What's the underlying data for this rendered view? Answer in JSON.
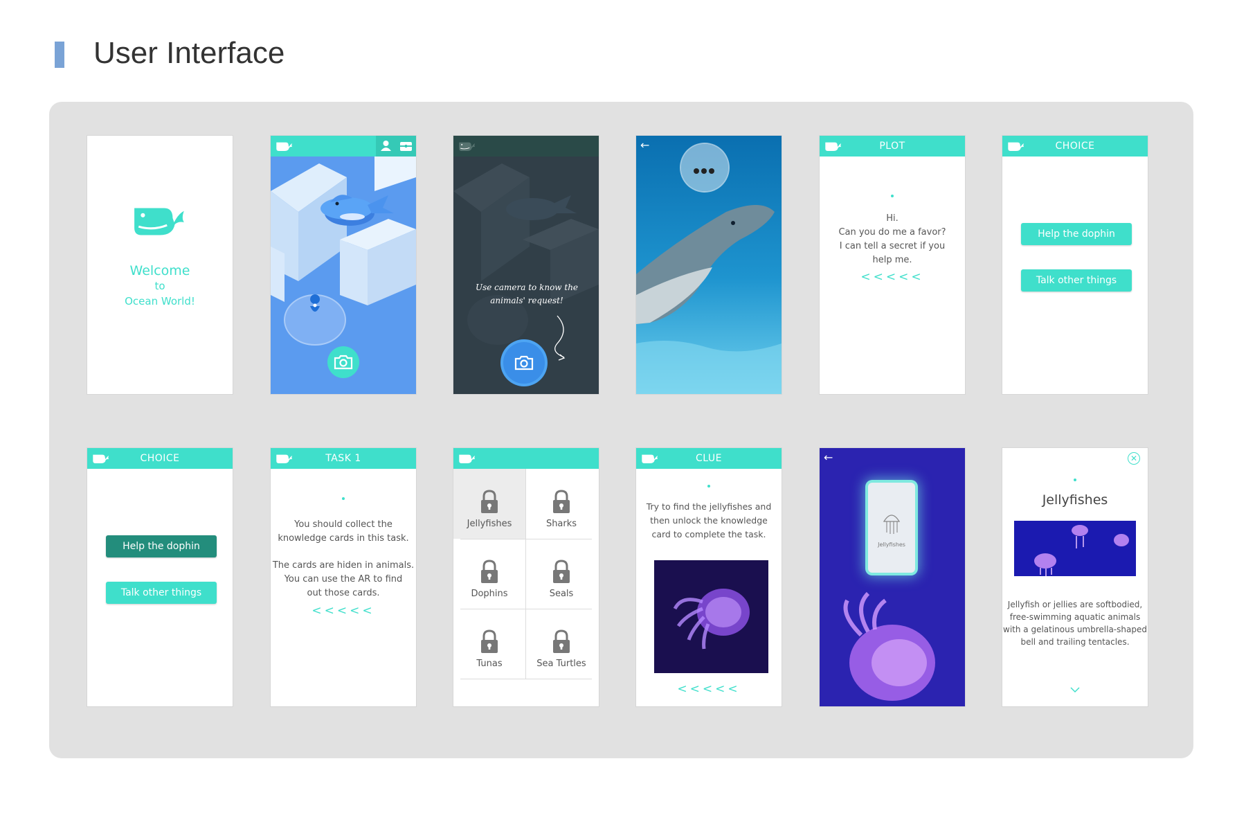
{
  "page": {
    "title": "User Interface"
  },
  "welcome": {
    "line1": "Welcome",
    "line2": "to",
    "line3": "Ocean World!"
  },
  "map_overlay": {
    "hint": "Use camera to know the animals' request!"
  },
  "plot": {
    "header": "PLOT",
    "line1": "Hi.",
    "line2": "Can you do me a favor?",
    "line3": "I can tell a secret if you",
    "line4": "help me.",
    "chevrons": "<<<<<"
  },
  "choice_a": {
    "header": "CHOICE",
    "btn1": "Help the dophin",
    "btn2": "Talk other things"
  },
  "choice_b": {
    "header": "CHOICE",
    "btn1": "Help the dophin",
    "btn2": "Talk other things"
  },
  "task": {
    "header": "TASK 1",
    "line1": "You should collect the",
    "line2": "knowledge cards in this task.",
    "line3": "The cards are hiden in animals.",
    "line4": "You can use the AR to find",
    "line5": "out those cards.",
    "chevrons": "<<<<<"
  },
  "cards": {
    "items": [
      "Jellyfishes",
      "Sharks",
      "Dophins",
      "Seals",
      "Tunas",
      "Sea Turtles"
    ]
  },
  "clue": {
    "header": "CLUE",
    "line1": "Try to find the jellyfishes and",
    "line2": "then unlock the knowledge",
    "line3": "card to complete the task.",
    "chevrons": "<<<<<"
  },
  "ar_card": {
    "label": "Jellyfishes"
  },
  "detail": {
    "title": "Jellyfishes",
    "line1": "Jellyfish or jellies are softbodied,",
    "line2": "free-swimming aquatic animals",
    "line3": "with a gelatinous umbrella-shaped",
    "line4": "bell and trailing tentacles."
  },
  "colors": {
    "accent": "#3fdfcb",
    "accent_dark": "#238d7c",
    "board": "#e1e1e1",
    "heading_bar": "#7aa3d6"
  }
}
